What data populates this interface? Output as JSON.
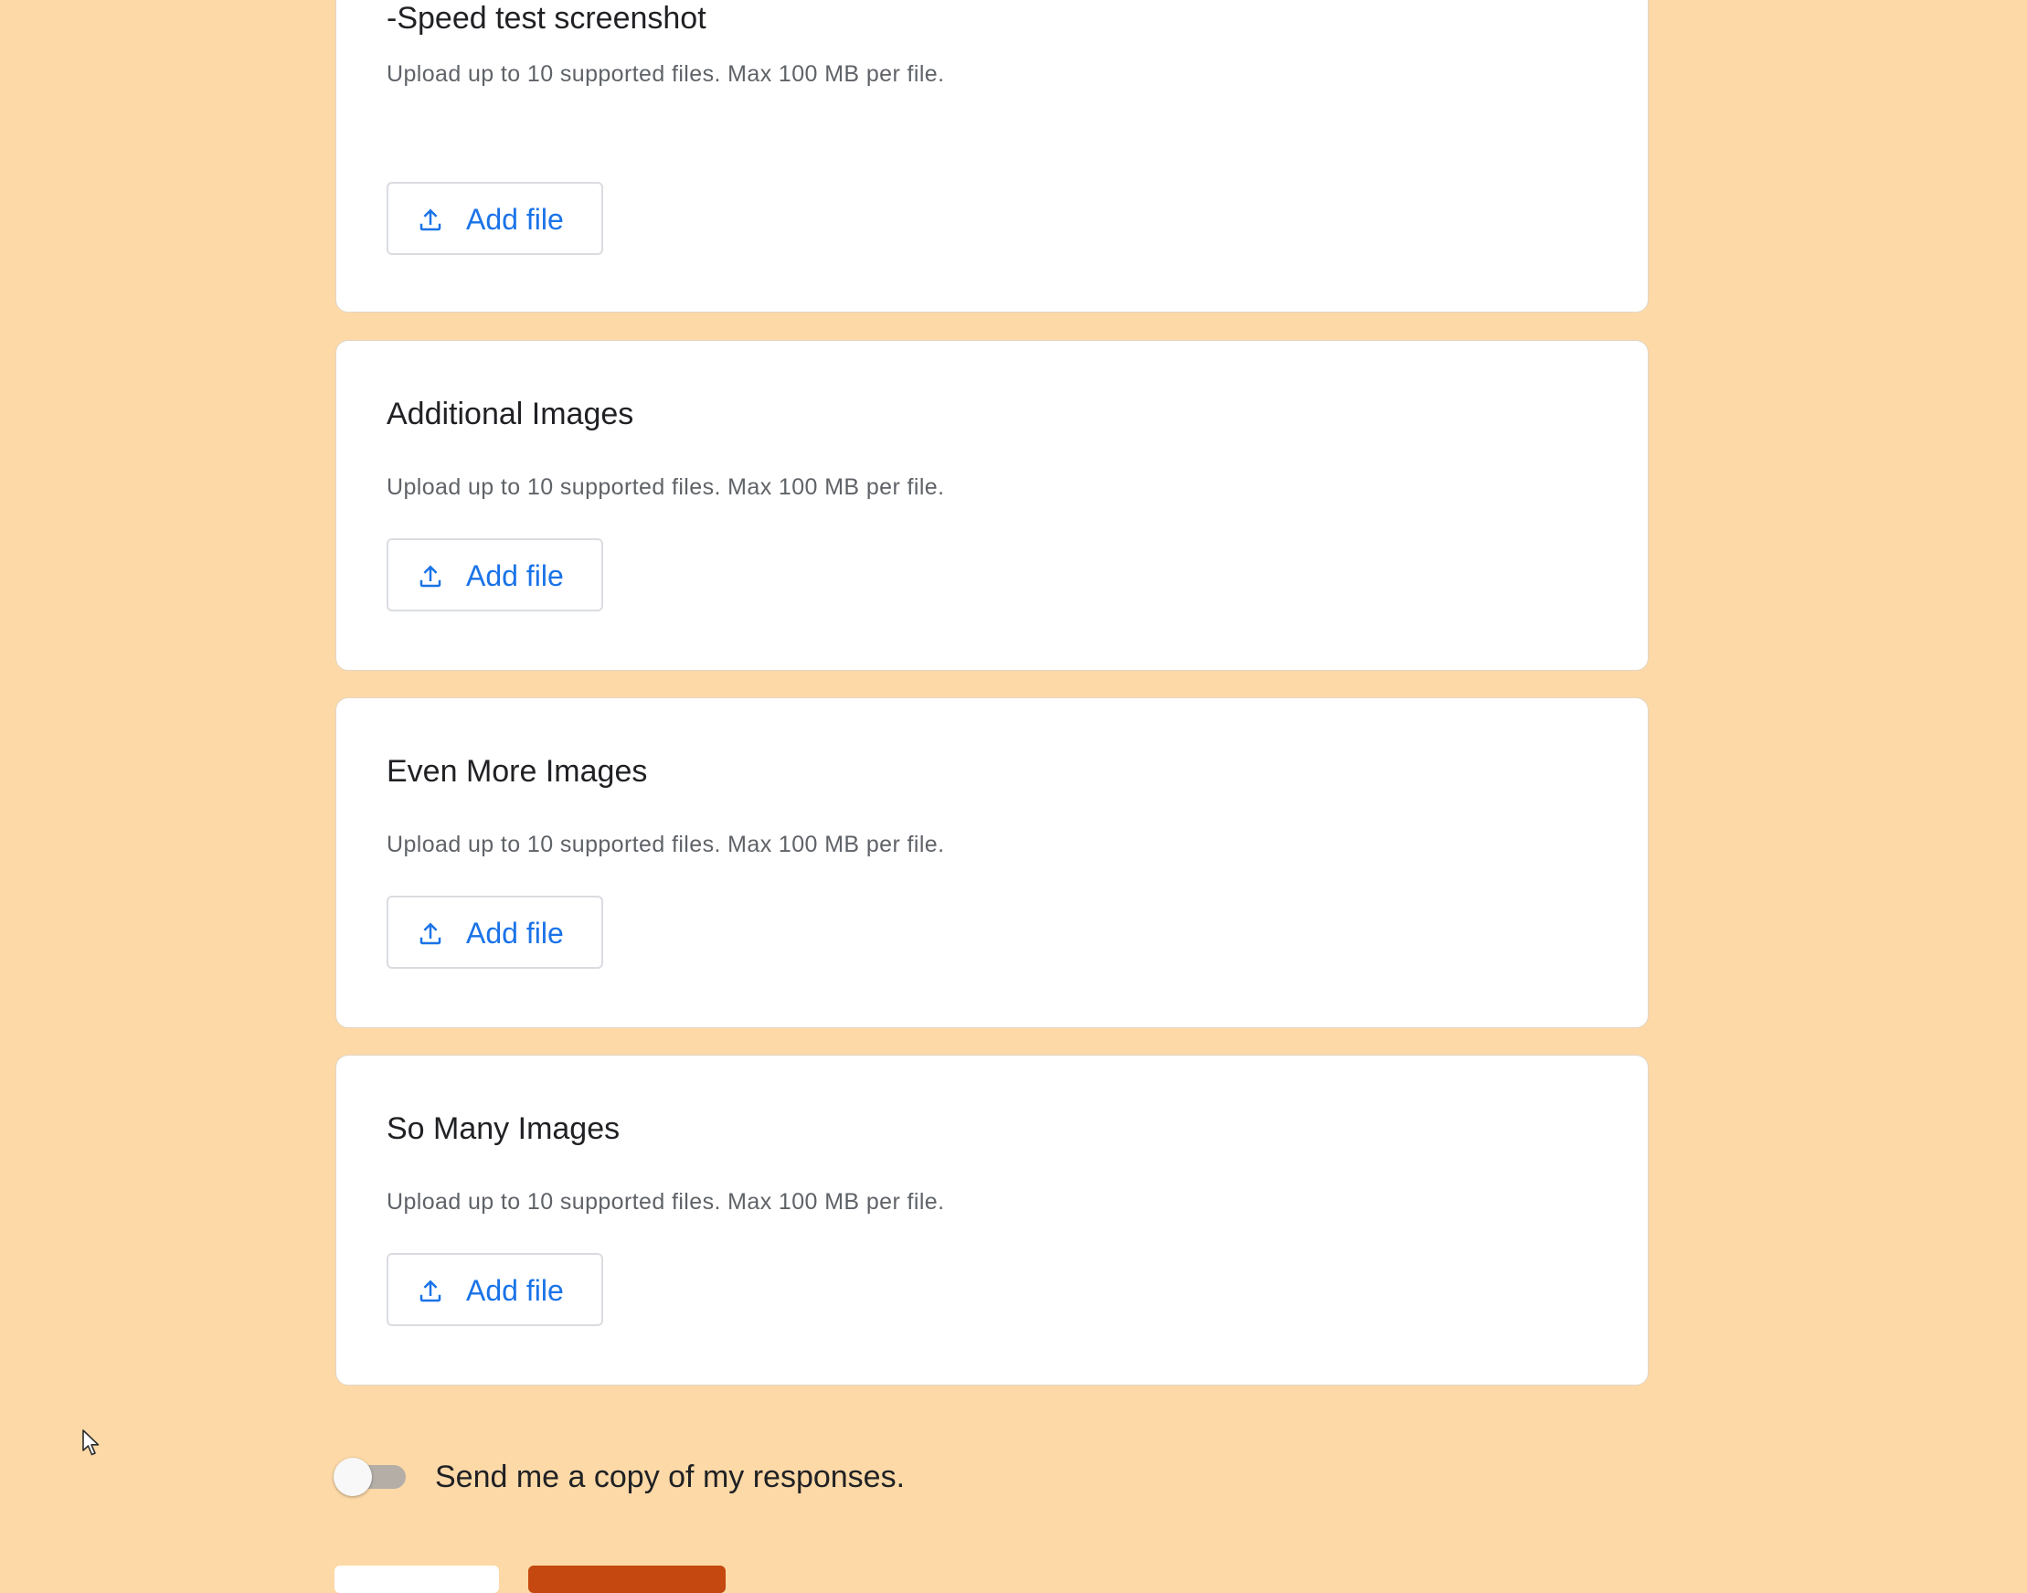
{
  "form": {
    "sections": [
      {
        "title": " -Speed test screenshot",
        "hint": "Upload up to 10 supported files. Max 100 MB per file.",
        "button_label": "Add file"
      },
      {
        "title": "Additional Images",
        "hint": "Upload up to 10 supported files. Max 100 MB per file.",
        "button_label": "Add file"
      },
      {
        "title": "Even More Images",
        "hint": "Upload up to 10 supported files. Max 100 MB per file.",
        "button_label": "Add file"
      },
      {
        "title": "So Many Images",
        "hint": "Upload up to 10 supported files. Max 100 MB per file.",
        "button_label": "Add file"
      }
    ],
    "copy_toggle": {
      "label": "Send me a copy of my responses.",
      "checked": false
    }
  },
  "icons": {
    "upload": "upload-icon",
    "cursor": "mouse-pointer-icon"
  },
  "colors": {
    "page_background": "#fdd9a7",
    "accent_link": "#1a73e8",
    "submit_button": "#c4480f"
  }
}
